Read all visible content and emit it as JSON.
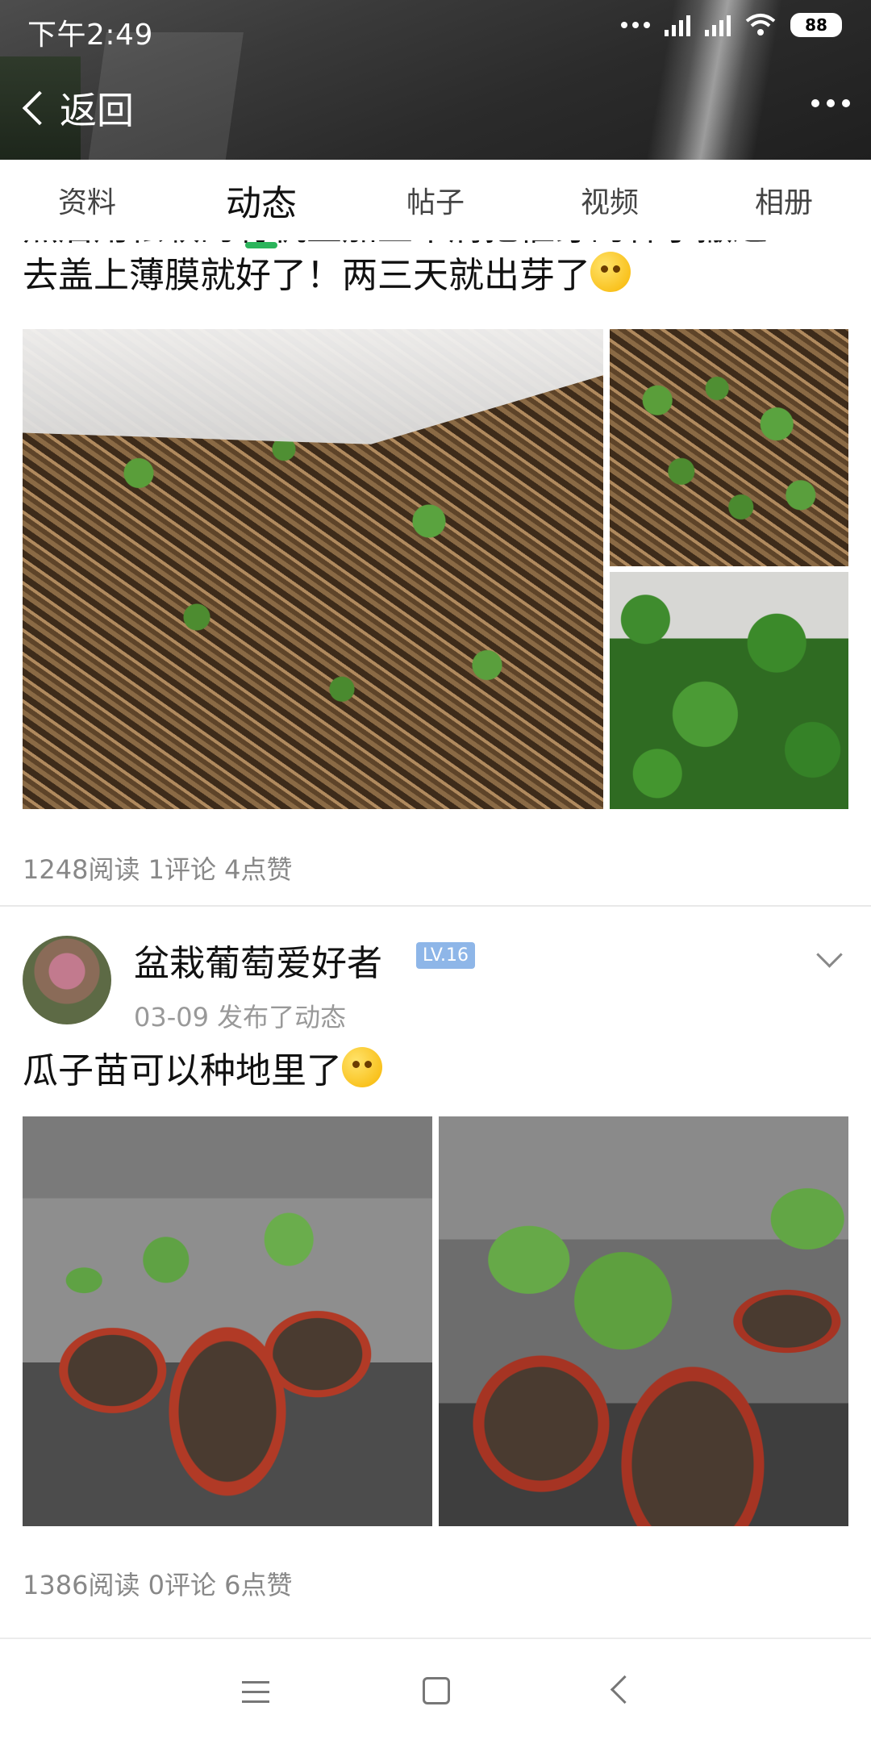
{
  "status_bar": {
    "time": "下午2:49",
    "battery": "88"
  },
  "nav": {
    "back_label": "返回"
  },
  "tabs": [
    {
      "label": "资料"
    },
    {
      "label": "动态"
    },
    {
      "label": "帖子"
    },
    {
      "label": "视频"
    },
    {
      "label": "相册"
    }
  ],
  "active_tab": "动态",
  "post1": {
    "text_line1": "然后用松软的有机土加上木屑把催芽的种子撒进",
    "text_line2": "去盖上薄膜就好了！两三天就出芽了",
    "stats": "1248阅读 1评论 4点赞"
  },
  "post2": {
    "username": "盆栽葡萄爱好者",
    "level": "LV.16",
    "meta": "03-09 发布了动态",
    "text": "瓜子苗可以种地里了",
    "stats": "1386阅读 0评论 6点赞"
  }
}
